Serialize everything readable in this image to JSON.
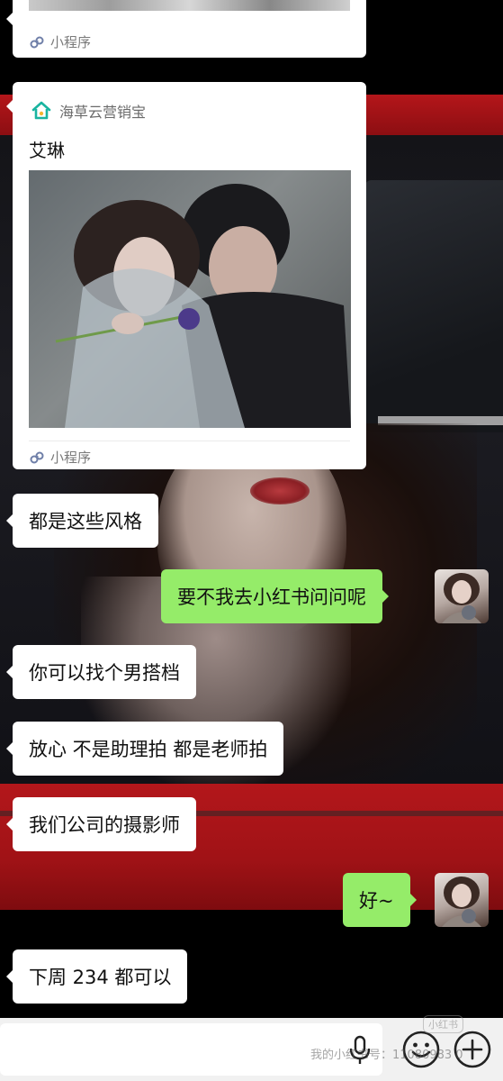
{
  "colors": {
    "incoming_bubble": "#ffffff",
    "outgoing_bubble": "#95ec69",
    "input_bar": "#f1f1f1",
    "app_icon": "#19b4a0"
  },
  "icons": {
    "app": "house-icon",
    "mini_program": "mini-program-icon",
    "voice": "voice-icon",
    "emoji": "emoji-icon",
    "more": "plus-icon"
  },
  "messages": [
    {
      "id": "m0",
      "type": "mini_program_card",
      "direction": "in",
      "footer": "小程序"
    },
    {
      "id": "m1",
      "type": "mini_program_card",
      "direction": "in",
      "app_name": "海草云营销宝",
      "title": "艾琳",
      "image": "wedding-couple-photo",
      "footer": "小程序"
    },
    {
      "id": "m2",
      "type": "text",
      "direction": "in",
      "text": "都是这些风格"
    },
    {
      "id": "m3",
      "type": "text",
      "direction": "out",
      "text": "要不我去小红书问问呢"
    },
    {
      "id": "m4",
      "type": "text",
      "direction": "in",
      "text": "你可以找个男搭档"
    },
    {
      "id": "m5",
      "type": "text",
      "direction": "in",
      "text": "放心  不是助理拍  都是老师拍"
    },
    {
      "id": "m6",
      "type": "text",
      "direction": "in",
      "text": "我们公司的摄影师"
    },
    {
      "id": "m7",
      "type": "text",
      "direction": "out",
      "text": "好~"
    },
    {
      "id": "m8",
      "type": "text",
      "direction": "in",
      "text": "下周 234 都可以"
    }
  ],
  "input_bar": {
    "voice_icon": "voice-icon",
    "emoji_icon": "emoji-icon",
    "plus_icon": "plus-icon"
  },
  "watermark": {
    "logo": "小红书",
    "text": "我的小红书号：11080983 0"
  }
}
